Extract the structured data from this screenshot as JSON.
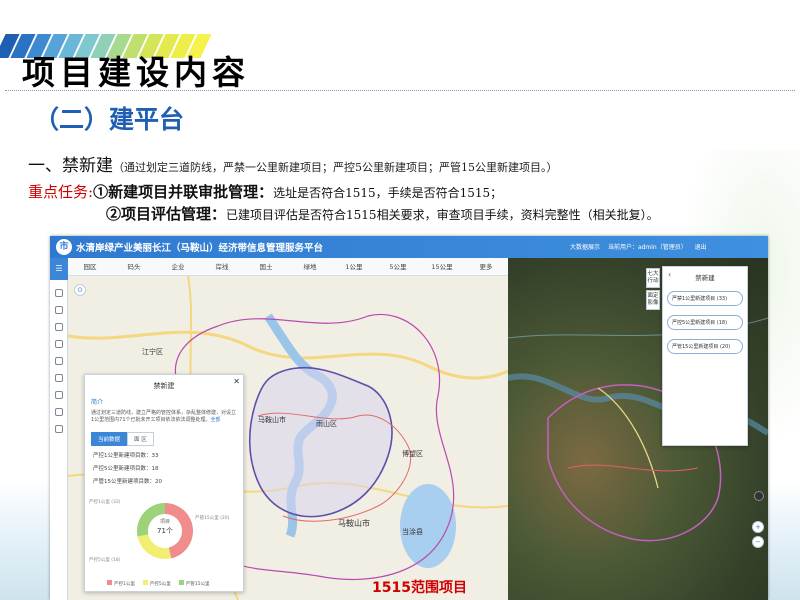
{
  "slide": {
    "title": "项目建设内容",
    "subtitle": "（二）建平台",
    "line1_main": "一、禁新建",
    "line1_note": "（通过划定三道防线，严禁一公里新建项目；严控5公里新建项目；严管15公里新建项目。）",
    "task_label": "重点任务:",
    "task1_num": "①",
    "task1_title": "新建项目并联审批管理：",
    "task1_text": "选址是否符合1515，手续是否符合1515；",
    "task2_num": "②",
    "task2_title": "项目评估管理：",
    "task2_text": "已建项目评估是否符合1515相关要求，审查项目手续，资料完整性（相关批复）。",
    "caption": "1515范围项目",
    "stripe_colors": [
      "#1f5fb3",
      "#2a72c2",
      "#3d8ad0",
      "#55a3d8",
      "#6ab8d9",
      "#7fc8cf",
      "#8fd0b6",
      "#a7d98f",
      "#bfe06f",
      "#d4e55a",
      "#e3ea4e",
      "#eeee48",
      "#f6f24c"
    ]
  },
  "app": {
    "logo": "市",
    "title": "水清岸绿产业美丽长江（马鞍山）经济带信息管理服务平台",
    "header_right": [
      "大数据展示",
      "当前用户：admin（管理员）",
      "退出"
    ],
    "tabs": [
      "园区",
      "码头",
      "企业",
      "岸线",
      "国土",
      "绿地",
      "1公里",
      "5公里",
      "15公里",
      "更多"
    ],
    "map_labels": [
      "雨山区",
      "博望区",
      "当涂县",
      "马鞍山市",
      "马鞍山市",
      "江宁区"
    ],
    "left_popup": {
      "title": "禁新建",
      "section": "简介",
      "text": "通过划定三道防线，建立严格的管控体系，杂乱整体修建，对设立1公里范围内71个已批未开工项目依法依法调整处理。",
      "more": "全部",
      "tab_active": "当前数据",
      "tab_other": "面 区",
      "stats": [
        "严控1公里新建项目数：33",
        "严控5公里新建项目数：18",
        "严管15公里新建项目数：20"
      ],
      "donut_center_label": "项目",
      "donut_center_value": "71个",
      "donut_labels": [
        "严控1公里 (33)",
        "严控5公里 (18)",
        "严管15公里 (20)"
      ],
      "legend": [
        "严控1公里",
        "严控5公里",
        "严管15公里"
      ],
      "legend_colors": [
        "#f08c8c",
        "#f2ee74",
        "#9bd27a"
      ],
      "donut_values": [
        33,
        18,
        20
      ]
    },
    "right_panel": {
      "title": "禁新建",
      "items": [
        "严禁1公里新建项目 (33)",
        "严控5公里新建项目 (18)",
        "严管15公里新建项目 (20)"
      ]
    },
    "vtabs": [
      "七大行动",
      "面定影像"
    ]
  },
  "colors": {
    "title_blue": "#1f5fb3",
    "task_red": "#d00000",
    "header_blue": "#2f7ad0"
  }
}
